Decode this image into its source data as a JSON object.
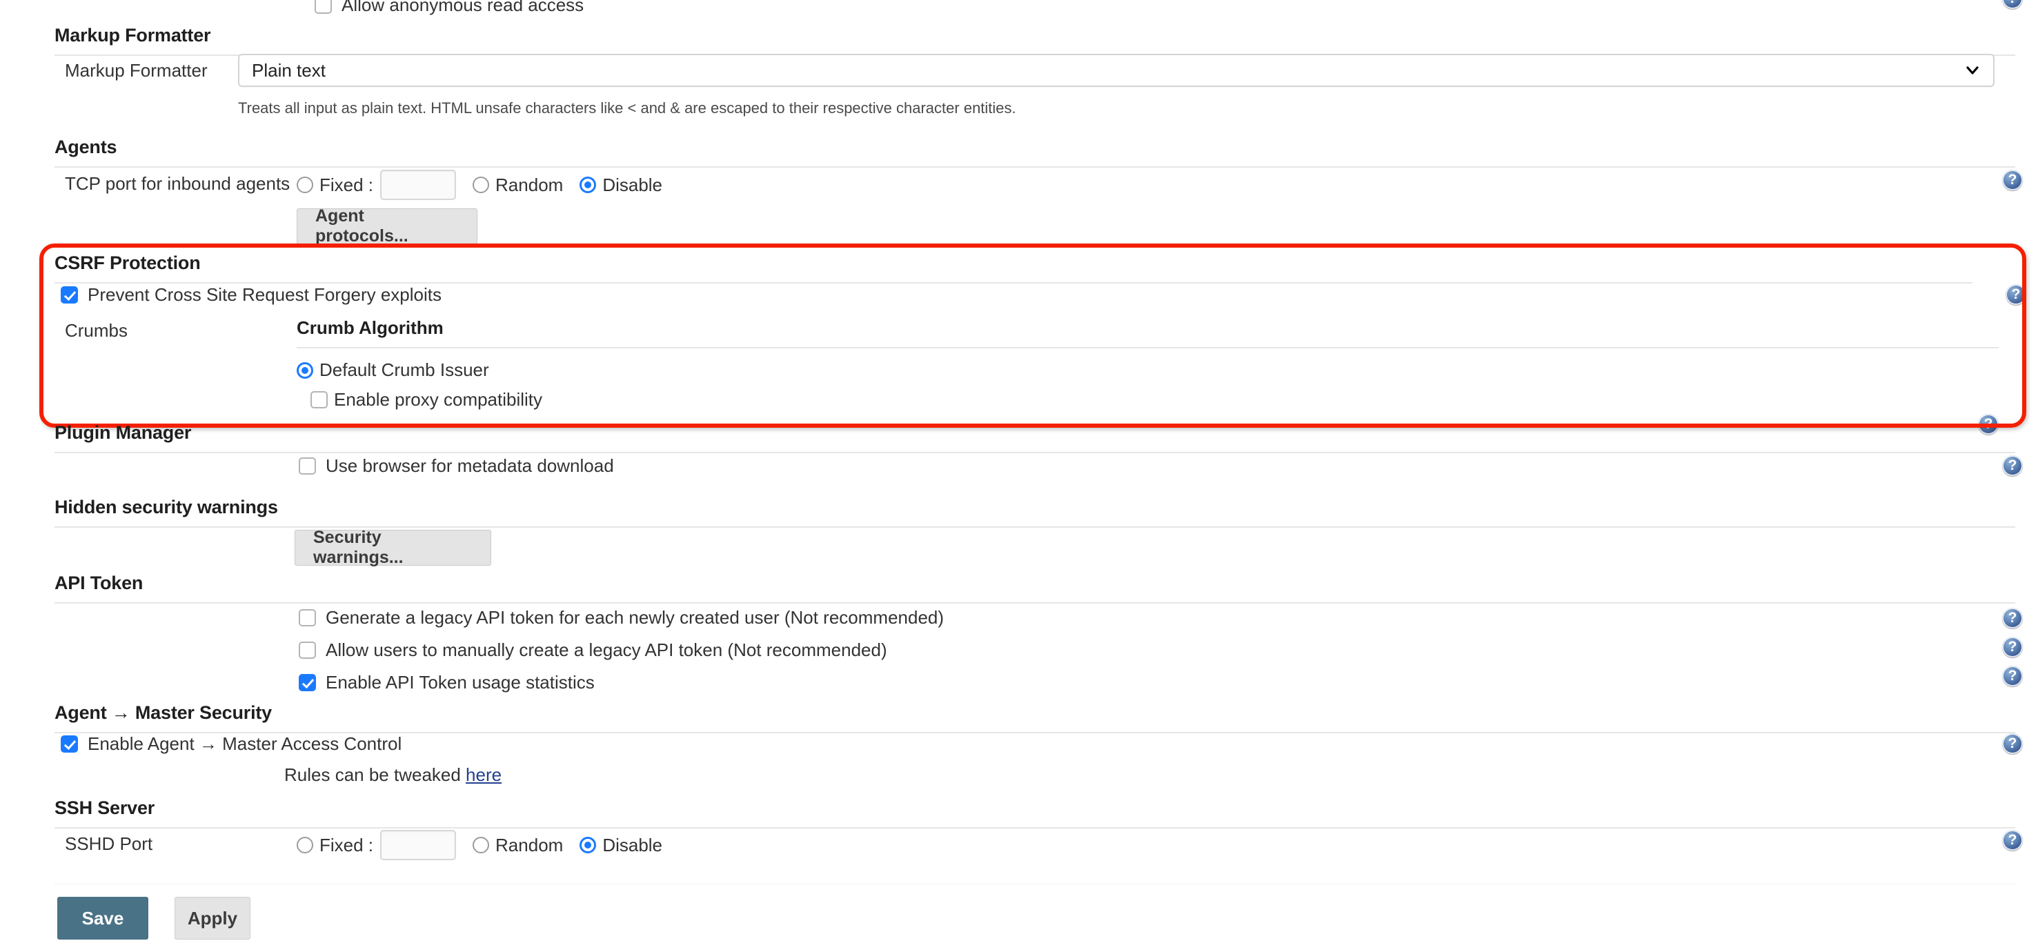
{
  "page": {
    "top_partial_row": {
      "label": "Allow anonymous read access",
      "checked": false
    },
    "sections": [
      {
        "id": "markup-formatter",
        "title": "Markup Formatter",
        "field_label": "Markup Formatter",
        "select_value": "Plain text",
        "description": "Treats all input as plain text. HTML unsafe characters like < and & are escaped to their respective character entities.",
        "chevron_icon": "chevron-down-icon"
      },
      {
        "id": "agents",
        "title": "Agents",
        "field_label": "TCP port for inbound agents",
        "options": [
          {
            "label": "Fixed :",
            "selected": false
          },
          {
            "label": "Random",
            "selected": false
          },
          {
            "label": "Disable",
            "selected": true
          }
        ],
        "fixed_port_value": "",
        "button_label": "Agent protocols..."
      },
      {
        "id": "csrf-protection",
        "title": "CSRF Protection",
        "highlighted": true,
        "prevent_csrf": {
          "label": "Prevent Cross Site Request Forgery exploits",
          "checked": true
        },
        "crumbs_label": "Crumbs",
        "crumb_algorithm": {
          "title": "Crumb Algorithm",
          "issuer": {
            "label": "Default Crumb Issuer",
            "selected": true
          },
          "proxy_compat": {
            "label": "Enable proxy compatibility",
            "checked": false
          }
        }
      },
      {
        "id": "plugin-manager",
        "title": "Plugin Manager",
        "metadata_download": {
          "label": "Use browser for metadata download",
          "checked": false
        }
      },
      {
        "id": "hidden-security-warnings",
        "title": "Hidden security warnings",
        "button_label": "Security warnings..."
      },
      {
        "id": "api-token",
        "title": "API Token",
        "checkboxes": [
          {
            "label": "Generate a legacy API token for each newly created user (Not recommended)",
            "checked": false
          },
          {
            "label": "Allow users to manually create a legacy API token (Not recommended)",
            "checked": false
          },
          {
            "label": "Enable API Token usage statistics",
            "checked": true
          }
        ]
      },
      {
        "id": "agent-master-security",
        "title": "Agent → Master Security",
        "enable_access_control": {
          "label": "Enable Agent → Master Access Control",
          "checked": true
        },
        "rules_text": "Rules can be tweaked ",
        "rules_link": "here"
      },
      {
        "id": "ssh-server",
        "title": "SSH Server",
        "field_label": "SSHD Port",
        "options": [
          {
            "label": "Fixed :",
            "selected": false
          },
          {
            "label": "Random",
            "selected": false
          },
          {
            "label": "Disable",
            "selected": true
          }
        ],
        "fixed_port_value": ""
      }
    ],
    "footer": {
      "save_label": "Save",
      "apply_label": "Apply"
    },
    "help_icon_glyph": "?",
    "colors": {
      "highlight_border": "#f42000",
      "accent_blue": "#1a7aff",
      "save_button": "#4a7286",
      "help_icon": "#4a6fa5",
      "link": "#23408e"
    }
  }
}
